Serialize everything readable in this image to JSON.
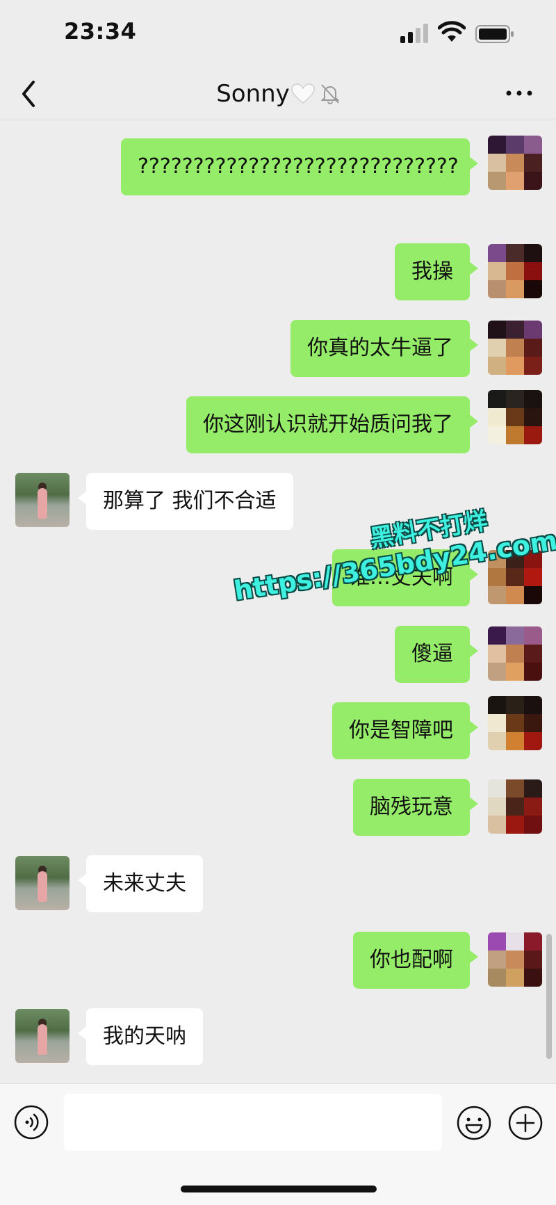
{
  "status_bar": {
    "time": "23:34"
  },
  "nav": {
    "title": "Sonny",
    "title_emoji": "🤍"
  },
  "messages": [
    {
      "side": "out",
      "text": "?????????????????????????????"
    },
    {
      "side": "out",
      "text": "我操"
    },
    {
      "side": "out",
      "text": "你真的太牛逼了"
    },
    {
      "side": "out",
      "text": "你这刚认识就开始质问我了"
    },
    {
      "side": "in",
      "text": "那算了 我们不合适"
    },
    {
      "side": "out",
      "text": "谁…丈夫啊"
    },
    {
      "side": "out",
      "text": "傻逼"
    },
    {
      "side": "out",
      "text": "你是智障吧"
    },
    {
      "side": "out",
      "text": "脑残玩意"
    },
    {
      "side": "in",
      "text": "未来丈夫"
    },
    {
      "side": "out",
      "text": "你也配啊"
    },
    {
      "side": "in",
      "text": "我的天呐"
    }
  ],
  "watermark": {
    "line1": "黑料不打烊",
    "line2": "https://365bdy24.com"
  },
  "input": {
    "placeholder": ""
  },
  "colors": {
    "out_bubble": "#95ec69",
    "in_bubble": "#ffffff",
    "background": "#ededed",
    "watermark": "#3ef0e0"
  },
  "icons": [
    "back-chevron-icon",
    "heart-icon",
    "mute-bell-icon",
    "more-icon",
    "voice-icon",
    "emoji-icon",
    "plus-icon",
    "signal-icon",
    "wifi-icon",
    "battery-icon"
  ]
}
